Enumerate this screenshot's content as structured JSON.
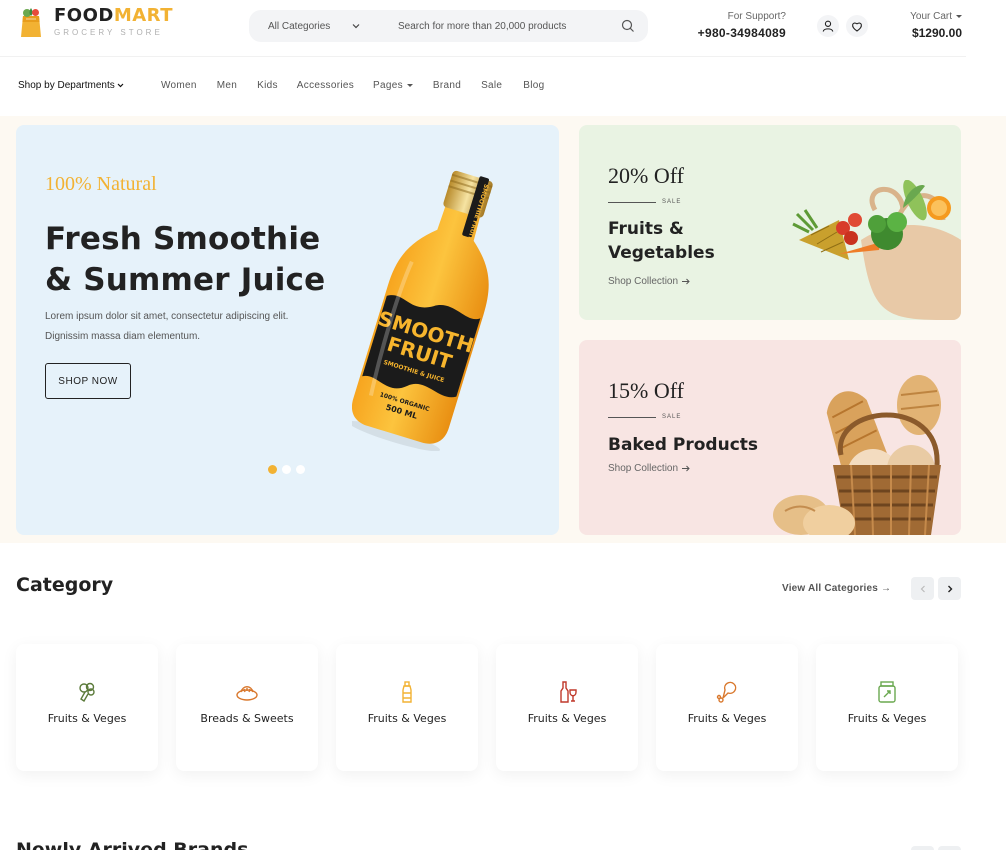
{
  "brand": {
    "name_part1": "FOOD",
    "name_part2": "MART",
    "tagline": "GROCERY STORE"
  },
  "search": {
    "category": "All Categories",
    "placeholder": "Search for more than 20,000 products"
  },
  "support": {
    "label": "For Support?",
    "phone": "+980-34984089"
  },
  "cart": {
    "label": "Your Cart",
    "total": "$1290.00"
  },
  "nav": {
    "departments": "Shop by Departments",
    "links": [
      "Women",
      "Men",
      "Kids",
      "Accessories",
      "Pages",
      "Brand",
      "Sale",
      "Blog"
    ]
  },
  "hero": {
    "tag": "100% Natural",
    "title_line1": "Fresh Smoothie",
    "title_line2": "& Summer Juice",
    "description_line1": "Lorem ipsum dolor sit amet, consectetur adipiscing elit.",
    "description_line2": "Dignissim massa diam elementum.",
    "button": "SHOP NOW",
    "bottle_text1": "SMOOTH",
    "bottle_text2": "FRUIT",
    "bottle_text3": "SMOOTHIE & JUICE",
    "bottle_text4": "100% ORGANIC",
    "bottle_text5": "500 ML",
    "bottle_cap": "SMOOTHIE FRUIT",
    "slides": 3,
    "active_slide": 1
  },
  "promos": [
    {
      "discount": "20% Off",
      "sale": "SALE",
      "title_line1": "Fruits &",
      "title_line2": "Vegetables",
      "link": "Shop Collection"
    },
    {
      "discount": "15% Off",
      "sale": "SALE",
      "title_line1": "Baked Products",
      "title_line2": "",
      "link": "Shop Collection"
    }
  ],
  "category": {
    "heading": "Category",
    "view_all": "View All Categories →",
    "items": [
      {
        "label": "Fruits & Veges",
        "icon": "broccoli-icon",
        "color": "#5b7a3a"
      },
      {
        "label": "Breads & Sweets",
        "icon": "bread-icon",
        "color": "#d9782d"
      },
      {
        "label": "Fruits & Veges",
        "icon": "bottle-icon",
        "color": "#f2b233"
      },
      {
        "label": "Fruits & Veges",
        "icon": "wine-icon",
        "color": "#c0392b"
      },
      {
        "label": "Fruits & Veges",
        "icon": "drumstick-icon",
        "color": "#d9782d"
      },
      {
        "label": "Fruits & Veges",
        "icon": "jar-icon",
        "color": "#6aa84f"
      }
    ]
  },
  "next_section": {
    "heading": "Newly Arrived Brands"
  },
  "colors": {
    "accent": "#f2b233",
    "hero_bg": "#e6f2fa",
    "promo_green": "#e9f3e3",
    "promo_pink": "#f8e5e3",
    "page_band": "#fdf9f2"
  }
}
